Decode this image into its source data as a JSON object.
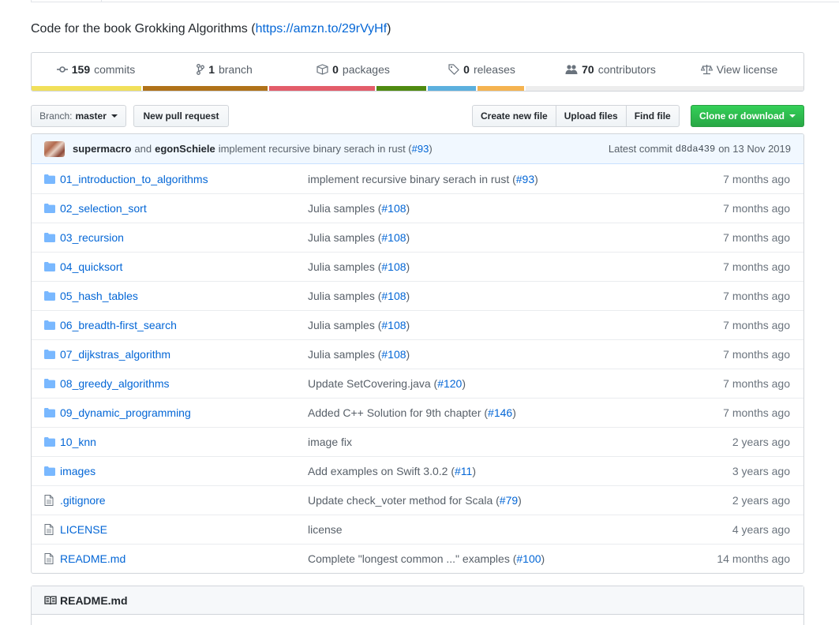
{
  "repo": {
    "description_prefix": "Code for the book Grokking Algorithms (",
    "description_link": "https://amzn.to/29rVyHf",
    "description_suffix": ")"
  },
  "summary": [
    {
      "icon": "history-icon",
      "count": "159",
      "label": "commits"
    },
    {
      "icon": "branch-icon",
      "count": "1",
      "label": "branch"
    },
    {
      "icon": "package-icon",
      "count": "0",
      "label": "packages"
    },
    {
      "icon": "tag-icon",
      "count": "0",
      "label": "releases"
    },
    {
      "icon": "people-icon",
      "count": "70",
      "label": "contributors"
    },
    {
      "icon": "law-icon",
      "count": "",
      "label": "View license"
    }
  ],
  "language_bar": [
    {
      "color": "#f1e05a",
      "share": 14.4
    },
    {
      "color": "#b07219",
      "share": 16.3
    },
    {
      "color": "#e35d6a",
      "share": 13.9
    },
    {
      "color": "#4f8a10",
      "share": 6.5
    },
    {
      "color": "#5cb0de",
      "share": 6.4
    },
    {
      "color": "#f5b350",
      "share": 6.1
    },
    {
      "color": "#ededed",
      "share": 36.4
    }
  ],
  "toolbar": {
    "branch_prefix": "Branch:",
    "branch_name": "master",
    "new_pr": "New pull request",
    "create_file": "Create new file",
    "upload_files": "Upload files",
    "find_file": "Find file",
    "clone": "Clone or download"
  },
  "latest_commit": {
    "author1": "supermacro",
    "and": "and",
    "author2": "egonSchiele",
    "message": "implement recursive binary serach in rust (",
    "issue": "#93",
    "message_end": ")",
    "label": "Latest commit",
    "sha": "d8da439",
    "date": "on 13 Nov 2019"
  },
  "files": [
    {
      "type": "dir",
      "name": "01_introduction_to_algorithms",
      "msg": "implement recursive binary serach in rust (",
      "issue": "#93",
      "age": "7 months ago"
    },
    {
      "type": "dir",
      "name": "02_selection_sort",
      "msg": "Julia samples (",
      "issue": "#108",
      "age": "7 months ago"
    },
    {
      "type": "dir",
      "name": "03_recursion",
      "msg": "Julia samples (",
      "issue": "#108",
      "age": "7 months ago"
    },
    {
      "type": "dir",
      "name": "04_quicksort",
      "msg": "Julia samples (",
      "issue": "#108",
      "age": "7 months ago"
    },
    {
      "type": "dir",
      "name": "05_hash_tables",
      "msg": "Julia samples (",
      "issue": "#108",
      "age": "7 months ago"
    },
    {
      "type": "dir",
      "name": "06_breadth-first_search",
      "msg": "Julia samples (",
      "issue": "#108",
      "age": "7 months ago"
    },
    {
      "type": "dir",
      "name": "07_dijkstras_algorithm",
      "msg": "Julia samples (",
      "issue": "#108",
      "age": "7 months ago"
    },
    {
      "type": "dir",
      "name": "08_greedy_algorithms",
      "msg": "Update SetCovering.java (",
      "issue": "#120",
      "age": "7 months ago"
    },
    {
      "type": "dir",
      "name": "09_dynamic_programming",
      "msg": "Added C++ Solution for 9th chapter (",
      "issue": "#146",
      "age": "7 months ago"
    },
    {
      "type": "dir",
      "name": "10_knn",
      "msg": "image fix",
      "issue": "",
      "age": "2 years ago"
    },
    {
      "type": "dir",
      "name": "images",
      "msg": "Add examples on Swift 3.0.2 (",
      "issue": "#11",
      "age": "3 years ago"
    },
    {
      "type": "file",
      "name": ".gitignore",
      "msg": "Update check_voter method for Scala (",
      "issue": "#79",
      "age": "2 years ago"
    },
    {
      "type": "file",
      "name": "LICENSE",
      "msg": "license",
      "issue": "",
      "age": "4 years ago"
    },
    {
      "type": "file",
      "name": "README.md",
      "msg": "Complete \"longest common ...\" examples (",
      "issue": "#100",
      "age": "14 months ago"
    }
  ],
  "readme": {
    "title": "README.md"
  }
}
